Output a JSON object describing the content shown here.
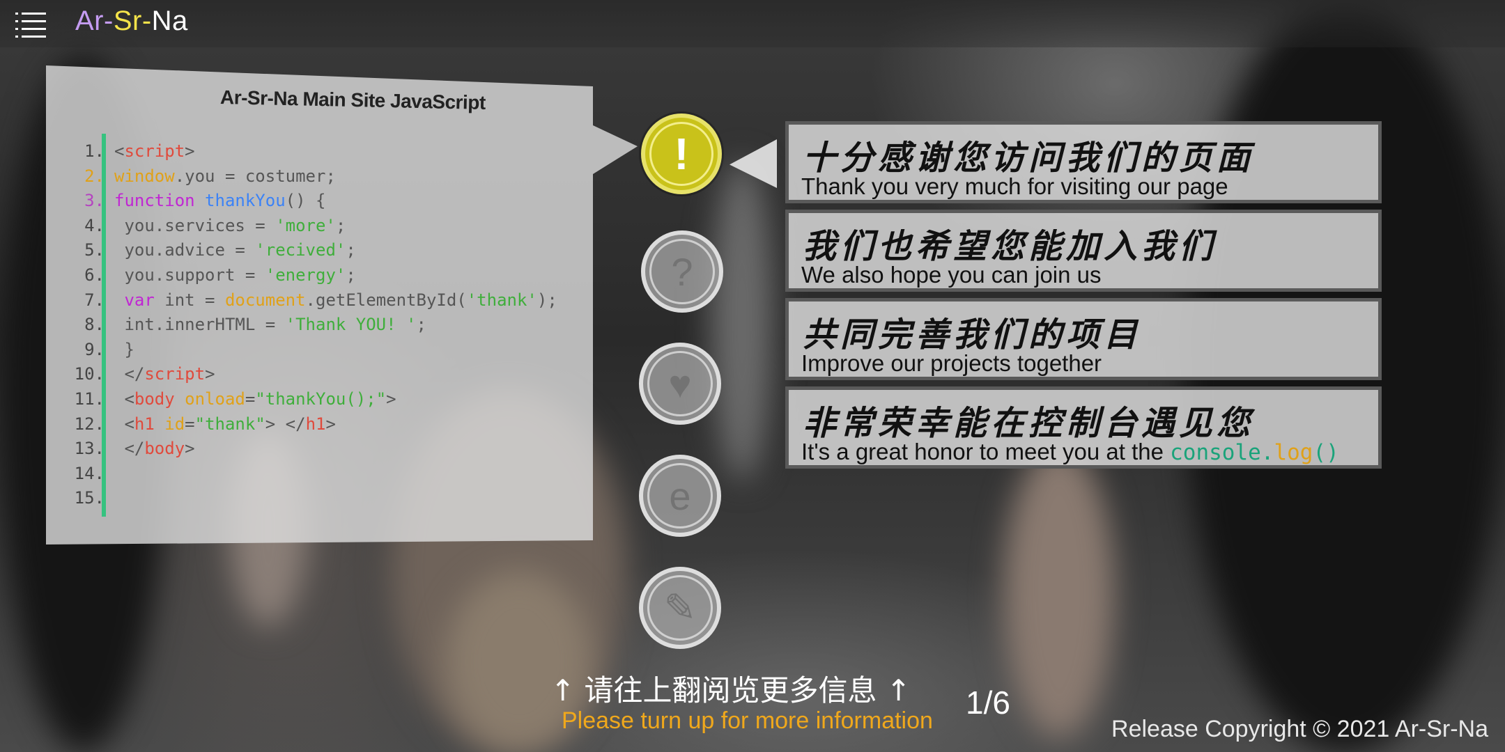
{
  "header": {
    "logo_part1": "Ar-",
    "logo_part2": "Sr-",
    "logo_part3": "Na",
    "menu_icon": "hamburger-menu-icon"
  },
  "code_panel": {
    "title": "Ar-Sr-Na Main Site JavaScript",
    "lines": [
      {
        "num": "1.",
        "segments": [
          {
            "t": "<",
            "c": "gray"
          },
          {
            "t": "script",
            "c": "red"
          },
          {
            "t": ">",
            "c": "gray"
          }
        ]
      },
      {
        "num": "2.",
        "num_color": "orange",
        "segments": [
          {
            "t": "window",
            "c": "orange"
          },
          {
            "t": ".you = costumer;",
            "c": "gray"
          }
        ]
      },
      {
        "num": "3.",
        "num_color": "purple",
        "segments": [
          {
            "t": "function ",
            "c": "purple"
          },
          {
            "t": "thankYou",
            "c": "blue"
          },
          {
            "t": "() {",
            "c": "gray"
          }
        ]
      },
      {
        "num": "4.",
        "segments": [
          {
            "t": " you.services = ",
            "c": "gray"
          },
          {
            "t": "'more'",
            "c": "green"
          },
          {
            "t": ";",
            "c": "gray"
          }
        ]
      },
      {
        "num": "5.",
        "segments": [
          {
            "t": " you.advice = ",
            "c": "gray"
          },
          {
            "t": "'recived'",
            "c": "green"
          },
          {
            "t": ";",
            "c": "gray"
          }
        ]
      },
      {
        "num": "6.",
        "segments": [
          {
            "t": " you.support = ",
            "c": "gray"
          },
          {
            "t": "'energy'",
            "c": "green"
          },
          {
            "t": ";",
            "c": "gray"
          }
        ]
      },
      {
        "num": "7.",
        "segments": [
          {
            "t": " var ",
            "c": "purple"
          },
          {
            "t": "int = ",
            "c": "gray"
          },
          {
            "t": "document",
            "c": "orange"
          },
          {
            "t": ".getElementById(",
            "c": "gray"
          },
          {
            "t": "'thank'",
            "c": "green"
          },
          {
            "t": ");",
            "c": "gray"
          }
        ]
      },
      {
        "num": "8.",
        "segments": [
          {
            "t": " int.innerHTML = ",
            "c": "gray"
          },
          {
            "t": "'Thank YOU! '",
            "c": "green"
          },
          {
            "t": ";",
            "c": "gray"
          }
        ]
      },
      {
        "num": "9.",
        "segments": [
          {
            "t": " }",
            "c": "gray"
          }
        ]
      },
      {
        "num": "10.",
        "segments": [
          {
            "t": " </",
            "c": "gray"
          },
          {
            "t": "script",
            "c": "red"
          },
          {
            "t": ">",
            "c": "gray"
          }
        ]
      },
      {
        "num": "11.",
        "segments": [
          {
            "t": " <",
            "c": "gray"
          },
          {
            "t": "body ",
            "c": "red"
          },
          {
            "t": "onload",
            "c": "orange"
          },
          {
            "t": "=",
            "c": "gray"
          },
          {
            "t": "\"thankYou();\"",
            "c": "green"
          },
          {
            "t": ">",
            "c": "gray"
          }
        ]
      },
      {
        "num": "12.",
        "segments": [
          {
            "t": " <",
            "c": "gray"
          },
          {
            "t": "h1 ",
            "c": "red"
          },
          {
            "t": "id",
            "c": "orange"
          },
          {
            "t": "=",
            "c": "gray"
          },
          {
            "t": "\"thank\"",
            "c": "green"
          },
          {
            "t": "> </",
            "c": "gray"
          },
          {
            "t": "h1",
            "c": "red"
          },
          {
            "t": ">",
            "c": "gray"
          }
        ]
      },
      {
        "num": "13.",
        "segments": [
          {
            "t": " </",
            "c": "gray"
          },
          {
            "t": "body",
            "c": "red"
          },
          {
            "t": ">",
            "c": "gray"
          }
        ]
      },
      {
        "num": "14.",
        "segments": []
      },
      {
        "num": "15.",
        "segments": []
      }
    ]
  },
  "nav_icons": [
    {
      "name": "exclamation-icon",
      "glyph": "!",
      "active": true
    },
    {
      "name": "question-icon",
      "glyph": "?",
      "active": false
    },
    {
      "name": "heart-icon",
      "glyph": "♥",
      "active": false
    },
    {
      "name": "edge-browser-icon",
      "glyph": "e",
      "active": false
    },
    {
      "name": "document-edit-icon",
      "glyph": "✎",
      "active": false
    }
  ],
  "messages": [
    {
      "cn": "十分感谢您访问我们的页面",
      "en": "Thank you very much for visiting our page"
    },
    {
      "cn": "我们也希望您能加入我们",
      "en": "We also hope you can join us"
    },
    {
      "cn": "共同完善我们的项目",
      "en": "Improve our projects together"
    },
    {
      "cn": "非常荣幸能在控制台遇见您",
      "en": "It's a great honor to meet you at the ",
      "en_code_a": "console.",
      "en_code_b": "log",
      "en_code_c": "()"
    }
  ],
  "footer": {
    "hint_cn": "↑ 请往上翻阅览更多信息 ↑",
    "hint_en": "Please turn up for more information",
    "page": "1/6",
    "copyright": "Release Copyright © 2021 Ar-Sr-Na"
  },
  "colors": {
    "accent_yellow": "#c9c21a",
    "logo_purple": "#c59cf2",
    "logo_yellow": "#f4e34a",
    "hint_orange": "#f0a81c",
    "gutter_green": "#36c27f"
  }
}
